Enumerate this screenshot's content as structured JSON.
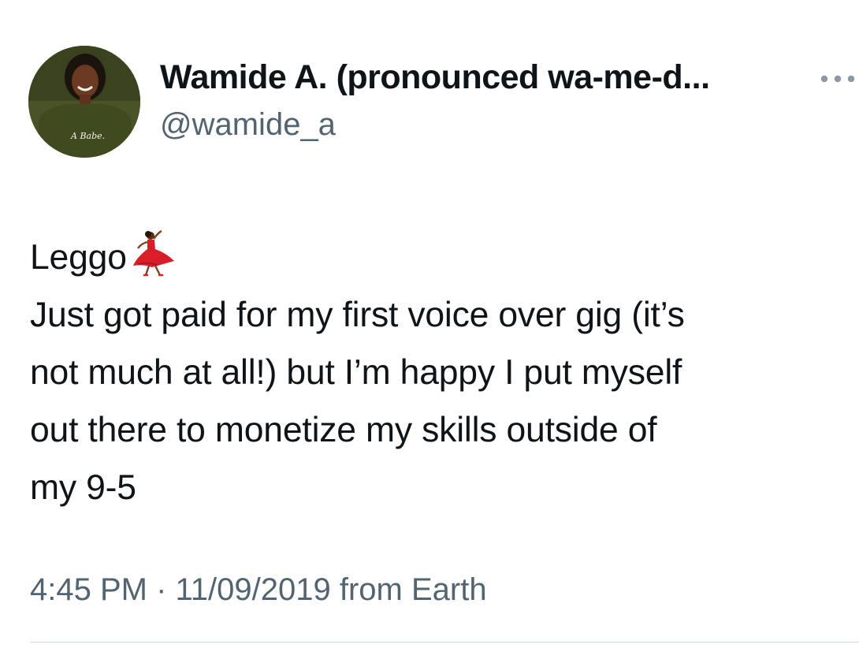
{
  "author": {
    "display_name": "Wamide A. (pronounced wa-me-d...",
    "handle": "@wamide_a",
    "avatar_shirt_text": "A Babe."
  },
  "more_icon": "more-horizontal-icon",
  "tweet": {
    "lines": [
      "Leggo",
      "Just got paid for my first voice over gig (it’s",
      "not much at all!) but I’m happy I put myself",
      "out there to monetize my skills outside of",
      "my 9-5"
    ],
    "emoji": "dancing-woman-emoji"
  },
  "meta": {
    "time": "4:45 PM",
    "separator": " · ",
    "date": "11/09/2019",
    "source": " from Earth"
  },
  "colors": {
    "text": "#0f1419",
    "secondary": "#536471",
    "divider": "#cfd9de",
    "dress": "#d91e2a"
  }
}
